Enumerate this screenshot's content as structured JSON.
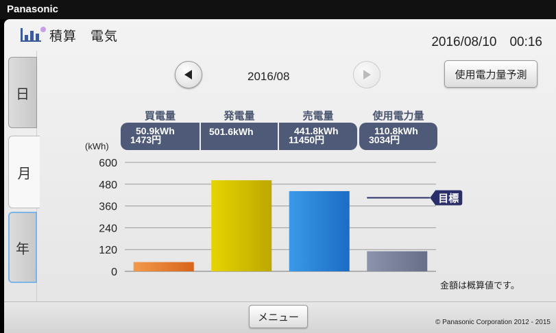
{
  "brand": "Panasonic",
  "header": {
    "title": "積算　電気",
    "datetime": "2016/08/10　00:16"
  },
  "tabs": [
    {
      "label": "日"
    },
    {
      "label": "月"
    },
    {
      "label": "年"
    }
  ],
  "period": {
    "label": "2016/08",
    "prev_icon": "triangle-left",
    "next_icon": "triangle-right"
  },
  "predict_button": "使用電力量予測",
  "legend": [
    {
      "name": "買電量",
      "kwh": "50.9kWh",
      "yen": "1473円",
      "color": "#e8792a"
    },
    {
      "name": "発電量",
      "kwh": "501.6kWh",
      "yen": "",
      "color": "#d9c400"
    },
    {
      "name": "売電量",
      "kwh": "441.8kWh",
      "yen": "11450円",
      "color": "#2a86dc"
    },
    {
      "name": "使用電力量",
      "kwh": "110.8kWh",
      "yen": "3034円",
      "color": "#7c849c"
    }
  ],
  "chart_data": {
    "type": "bar",
    "categories": [
      "買電量",
      "発電量",
      "売電量",
      "使用電力量"
    ],
    "values": [
      50.9,
      501.6,
      441.8,
      110.8
    ],
    "ylabel": "(kWh)",
    "ylim": [
      0,
      600
    ],
    "yticks": [
      "600",
      "480",
      "360",
      "240",
      "120",
      "0"
    ],
    "ytick_values": [
      600,
      480,
      360,
      240,
      120,
      0
    ],
    "grid": true,
    "target": {
      "label": "目標",
      "value": 405
    }
  },
  "note": "金額は概算値です。",
  "menu_button": "メニュー",
  "copyright": "© Panasonic Corporation 2012 - 2015"
}
